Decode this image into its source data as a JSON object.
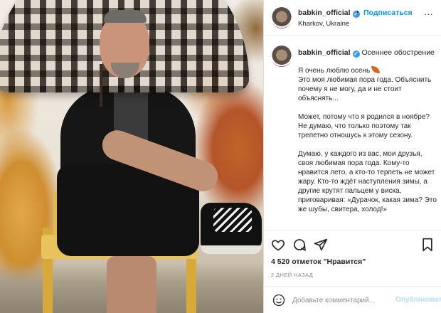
{
  "header": {
    "username": "babkin_official",
    "follow_label": "Подписаться",
    "dot": "•",
    "location": "Kharkov, Ukraine",
    "more": "···"
  },
  "caption": {
    "username": "babkin_official",
    "title": "Осеннее обострение",
    "paragraphs": [
      "Я очень люблю осень\nЭто моя любимая пора года. Объяснить почему я не могу, да и не стоит объяснять...",
      "Может, потому что я родился в ноябре? Не думаю, что только поэтому так трепетно отношусь к этому сезону.",
      "Думаю, у каждого из вас, мои друзья, своя любимая пора года. Кому-то нравится лето, а кто-то терпеть не может жару. Кто-то ждёт наступления зимы, а другие крутят пальцем у виска, приговаривая: «Дурачок, какая зима? Это же шубы, свитера, холод!»"
    ]
  },
  "likes": "4 520 отметок \"Нравится\"",
  "timestamp": "2 ДНЕЙ НАЗАД",
  "comment": {
    "placeholder": "Добавьте комментарий...",
    "post_label": "Опубликовать"
  },
  "icons": {
    "verified": "verified-badge",
    "leaf": "autumn-leaf",
    "heart": "heart",
    "comment": "comment-bubble",
    "share": "paper-plane",
    "save": "bookmark",
    "emoji": "smiley-face",
    "more": "three-dots"
  },
  "colors": {
    "link_blue": "#0095f6",
    "verified_blue": "#3897f0",
    "muted_gray": "#8e8e8e",
    "post_disabled": "#b2dffc"
  }
}
